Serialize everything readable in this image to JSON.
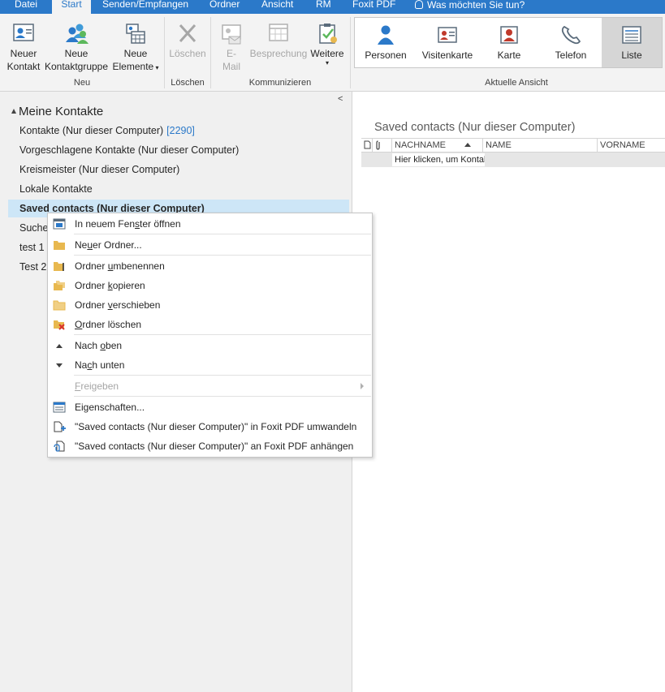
{
  "tabs": [
    {
      "label": "Datei",
      "active": false
    },
    {
      "label": "Start",
      "active": true
    },
    {
      "label": "Senden/Empfangen",
      "active": false
    },
    {
      "label": "Ordner",
      "active": false
    },
    {
      "label": "Ansicht",
      "active": false
    },
    {
      "label": "RM",
      "active": false
    },
    {
      "label": "Foxit PDF",
      "active": false
    }
  ],
  "tell_me": "Was möchten Sie tun?",
  "ribbon": {
    "neu": {
      "new_contact": [
        "Neuer",
        "Kontakt"
      ],
      "new_group": [
        "Neue",
        "Kontaktgruppe"
      ],
      "new_items": [
        "Neue",
        "Elemente"
      ],
      "label": "Neu"
    },
    "loeschen": {
      "delete": "Löschen",
      "label": "Löschen"
    },
    "kommunizieren": {
      "email": [
        "E-",
        "Mail"
      ],
      "meeting": "Besprechung",
      "more": "Weitere",
      "label": "Kommunizieren"
    },
    "aktuelle_ansicht": {
      "views": [
        "Personen",
        "Visitenkarte",
        "Karte",
        "Telefon",
        "Liste"
      ],
      "selected": "Liste",
      "label": "Aktuelle Ansicht"
    }
  },
  "folder_pane": {
    "group": "Meine Kontakte",
    "items": [
      {
        "label": "Kontakte (Nur dieser Computer)",
        "count": "[2290]"
      },
      {
        "label": "Vorgeschlagene Kontakte (Nur dieser Computer)",
        "count": ""
      },
      {
        "label": "Kreismeister (Nur dieser Computer)",
        "count": ""
      },
      {
        "label": "Lokale Kontakte",
        "count": ""
      },
      {
        "label": "Saved contacts (Nur dieser Computer)",
        "count": "",
        "selected": true
      },
      {
        "label": "Suchen",
        "count": ""
      },
      {
        "label": "test 1",
        "count": ""
      },
      {
        "label": "Test 2",
        "count": ""
      }
    ]
  },
  "content": {
    "title": "Saved contacts (Nur dieser Computer)",
    "columns": [
      "NACHNAME",
      "NAME",
      "VORNAME"
    ],
    "new_row_placeholder": "Hier klicken, um Kontakt hinzuzufügen"
  },
  "context_menu": {
    "items": [
      {
        "pre": "In neuem Fen",
        "key": "s",
        "post": "ter öffnen",
        "icon": "new-window-icon"
      },
      {
        "pre": "Ne",
        "key": "u",
        "post": "er Ordner...",
        "icon": "folder-icon"
      },
      {
        "pre": "Ordner ",
        "key": "u",
        "post": "mbenennen",
        "icon": "rename-folder-icon"
      },
      {
        "pre": "Ordner ",
        "key": "k",
        "post": "opieren",
        "icon": "copy-folder-icon"
      },
      {
        "pre": "Ordner ",
        "key": "v",
        "post": "erschieben",
        "icon": "move-folder-icon"
      },
      {
        "pre": "",
        "key": "O",
        "post": "rdner löschen",
        "icon": "delete-folder-icon"
      },
      {
        "pre": "Nach ",
        "key": "o",
        "post": "ben",
        "icon": "move-up-icon"
      },
      {
        "pre": "Na",
        "key": "c",
        "post": "h unten",
        "icon": "move-down-icon"
      },
      {
        "pre": "",
        "key": "F",
        "post": "reigeben",
        "icon": "",
        "disabled": true
      },
      {
        "pre": "Ei",
        "key": "g",
        "post": "enschaften...",
        "icon": "properties-icon"
      },
      {
        "pre": "\"Saved contacts (Nur dieser Computer)\" in Foxit PDF umwandeln",
        "key": "",
        "post": "",
        "icon": "foxit-convert-icon"
      },
      {
        "pre": "\"Saved contacts (Nur dieser Computer)\" an Foxit PDF anhängen",
        "key": "",
        "post": "",
        "icon": "foxit-append-icon"
      }
    ]
  },
  "colors": {
    "accent": "#2b79c9",
    "selection": "#cde6f7",
    "delete": "#d9322c",
    "folder": "#e8b84f"
  }
}
